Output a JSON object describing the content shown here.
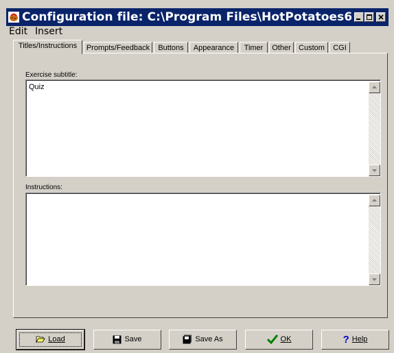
{
  "window": {
    "title": "Configuration file: C:\\Program Files\\HotPotatoes6\\..."
  },
  "menu": [
    {
      "label": "Edit"
    },
    {
      "label": "Insert"
    }
  ],
  "tabs": [
    {
      "label": "Titles/Instructions",
      "active": true
    },
    {
      "label": "Prompts/Feedback"
    },
    {
      "label": "Buttons"
    },
    {
      "label": "Appearance"
    },
    {
      "label": "Timer"
    },
    {
      "label": "Other"
    },
    {
      "label": "Custom"
    },
    {
      "label": "CGI"
    }
  ],
  "fields": {
    "subtitle": {
      "label": "Exercise subtitle:",
      "value": "Quiz"
    },
    "instructions": {
      "label": "Instructions:",
      "value": ""
    }
  },
  "buttons": [
    {
      "label": "Load",
      "icon": "folder-open-icon"
    },
    {
      "label": "Save",
      "icon": "floppy-disk-icon"
    },
    {
      "label": "Save As",
      "icon": "floppy-save-as-icon"
    },
    {
      "label": "OK",
      "icon": "checkmark-icon"
    },
    {
      "label": "Help",
      "icon": "question-mark-icon"
    }
  ],
  "colors": {
    "titlebar": "#0a246a",
    "face": "#d4d0c8",
    "ok_check": "#008000",
    "help_mark": "#0000cc"
  }
}
